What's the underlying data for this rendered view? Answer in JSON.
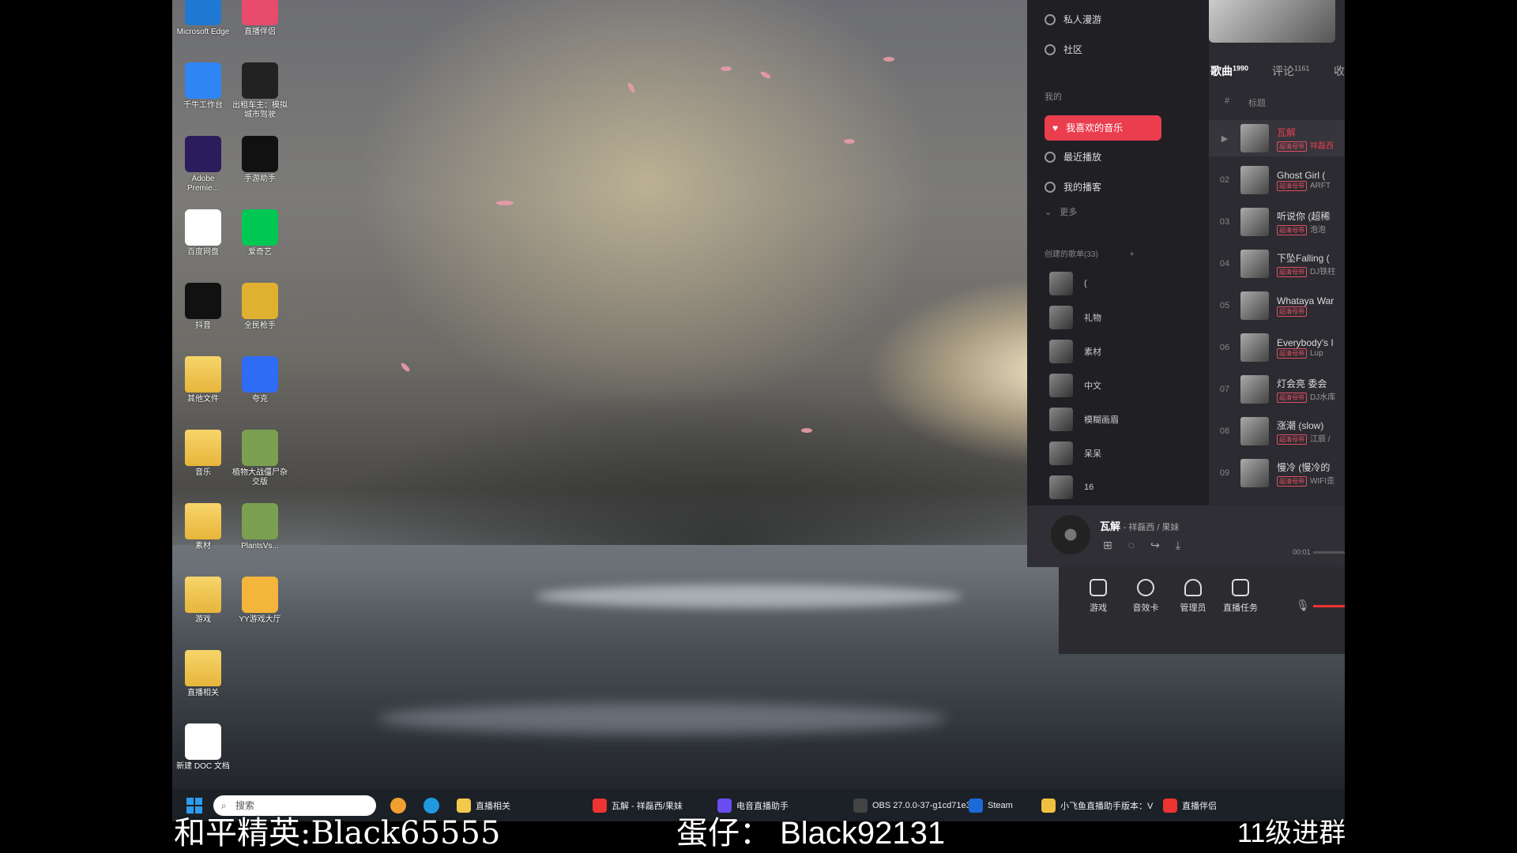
{
  "desktop": {
    "icons_col1": [
      {
        "label": "Microsoft Edge",
        "color": "#1f78d1"
      },
      {
        "label": "千牛工作台",
        "color": "#2e86f5"
      },
      {
        "label": "Adobe Premie...",
        "color": "#2b1d5c"
      },
      {
        "label": "百度网盘",
        "color": "#ffffff"
      },
      {
        "label": "抖音",
        "color": "#111111"
      },
      {
        "label": "其他文件",
        "color": "#f2c94c"
      },
      {
        "label": "音乐",
        "color": "#f2c94c"
      },
      {
        "label": "素材",
        "color": "#f2c94c"
      },
      {
        "label": "游戏",
        "color": "#f2c94c"
      },
      {
        "label": "直播相关",
        "color": "#f2c94c"
      },
      {
        "label": "新建 DOC 文档",
        "color": "#ffffff"
      }
    ],
    "icons_col2": [
      {
        "label": "直播伴侣",
        "color": "#e94b6a"
      },
      {
        "label": "出租车主：模拟城市驾驶",
        "color": "#222222"
      },
      {
        "label": "手游助手",
        "color": "#111111"
      },
      {
        "label": "爱奇艺",
        "color": "#00c853"
      },
      {
        "label": "全民枪手",
        "color": "#e0b030"
      },
      {
        "label": "夸克",
        "color": "#2e6cf5"
      },
      {
        "label": "植物大战僵尸杂交版",
        "color": "#7aa050"
      },
      {
        "label": "PlantsVs...",
        "color": "#7aa050"
      },
      {
        "label": "YY游戏大厅",
        "color": "#f3b63a"
      }
    ]
  },
  "music_app": {
    "nav_top": [
      "私人漫游",
      "社区"
    ],
    "section_mine": "我的",
    "liked_music": "我喜欢的音乐",
    "nav_mine": [
      "最近播放",
      "我的播客"
    ],
    "more": "更多",
    "created_playlists": "创建的歌单(33)",
    "playlists": [
      "(",
      "礼物",
      "素材",
      "中文",
      "模糊画眉",
      "呆呆",
      "16"
    ],
    "tabs": {
      "songs": "歌曲",
      "songs_count": "1990",
      "comments": "评论",
      "comments_count": "1161",
      "collect": "收"
    },
    "table_header": {
      "num": "#",
      "title": "标题"
    },
    "songs": [
      {
        "num": "",
        "title": "瓦解",
        "artist": "祥磊西",
        "playing": true
      },
      {
        "num": "02",
        "title": "Ghost Girl (",
        "artist": "ARFT"
      },
      {
        "num": "03",
        "title": "听说你 (超稀",
        "artist": "泡泡"
      },
      {
        "num": "04",
        "title": "下坠Falling (",
        "artist": "DJ铁柱"
      },
      {
        "num": "05",
        "title": "Whataya War",
        "artist": ""
      },
      {
        "num": "06",
        "title": "Everybody's I",
        "artist": "Lup"
      },
      {
        "num": "07",
        "title": "灯会亮 委会",
        "artist": "DJ水库"
      },
      {
        "num": "08",
        "title": "涨潮 (slow)",
        "artist": "江辰 / "
      },
      {
        "num": "09",
        "title": "慢冷 (慢冷的",
        "artist": "WIFI歪"
      }
    ],
    "player": {
      "title": "瓦解",
      "artist": "- 祥磊西 / 果妹",
      "time": "00:01"
    },
    "controls": [
      "游戏",
      "音效卡",
      "管理员",
      "直播任务"
    ]
  },
  "taskbar": {
    "search_placeholder": "搜索",
    "items": [
      "直播相关",
      "瓦解 - 祥磊西/果妹",
      "电音直播助手",
      "OBS 27.0.0-37-g1cd71e3",
      "Steam",
      "小飞鱼直播助手版本：V",
      "直播伴侣"
    ]
  },
  "overlay": {
    "left": "和平精英:Black65555",
    "middle": "蛋仔：  Black92131",
    "right": "11级进群"
  }
}
